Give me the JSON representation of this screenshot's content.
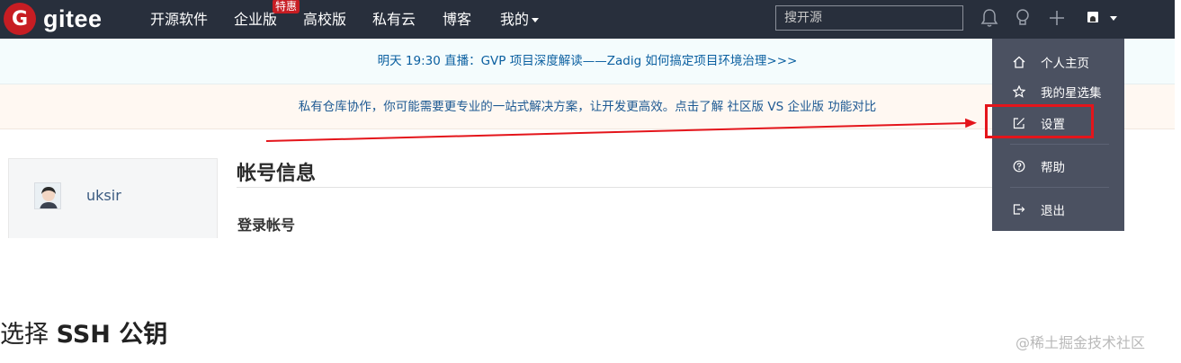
{
  "nav": {
    "logo_text": "gitee",
    "items": [
      "开源软件",
      "企业版",
      "高校版",
      "私有云",
      "博客",
      "我的"
    ],
    "badge": "特惠",
    "search_placeholder": "搜开源"
  },
  "banners": {
    "live": "明天 19:30 直播：GVP 项目深度解读——Zadig 如何搞定项目环境治理>>>",
    "promo": "私有仓库协作，你可能需要更专业的一站式解决方案，让开发更高效。点击了解 社区版 VS 企业版 功能对比"
  },
  "sidebar": {
    "username": "uksir"
  },
  "main": {
    "title": "帐号信息",
    "subtitle": "登录帐号"
  },
  "dropdown": {
    "items": [
      {
        "label": "个人主页",
        "icon": "home-icon"
      },
      {
        "label": "我的星选集",
        "icon": "star-icon"
      },
      {
        "label": "设置",
        "icon": "edit-icon"
      },
      {
        "label": "帮助",
        "icon": "help-icon"
      },
      {
        "label": "退出",
        "icon": "logout-icon"
      }
    ]
  },
  "bottom": {
    "title_prefix": "选择 ",
    "title_bold": "SSH 公钥"
  },
  "watermark": "@稀土掘金技术社区",
  "colors": {
    "navbar": "#282f3c",
    "brand": "#c71d23",
    "dropdown": "#4b5161",
    "annotation": "#e4151b"
  }
}
